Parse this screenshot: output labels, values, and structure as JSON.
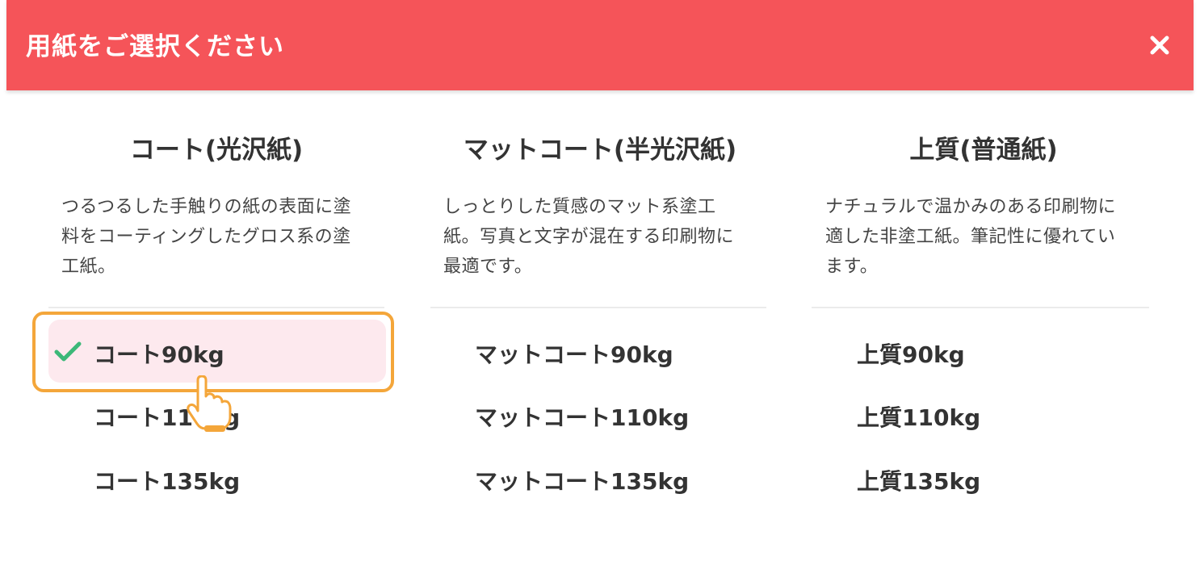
{
  "dialog": {
    "title": "用紙をご選択ください",
    "close_icon": "close-icon",
    "accent_color": "#f55459"
  },
  "columns": [
    {
      "heading": "コート(光沢紙)",
      "description": "つるつるした手触りの紙の表面に塗料をコーティングしたグロス系の塗工紙。",
      "options": [
        "コート90kg",
        "コート110kg",
        "コート135kg"
      ],
      "selected": "コート90kg"
    },
    {
      "heading": "マットコート(半光沢紙)",
      "description": "しっとりした質感のマット系塗工紙。写真と文字が混在する印刷物に最適です。",
      "options": [
        "マットコート90kg",
        "マットコート110kg",
        "マットコート135kg"
      ]
    },
    {
      "heading": "上質(普通紙)",
      "description": "ナチュラルで温かみのある印刷物に適した非塗工紙。筆記性に優れています。",
      "options": [
        "上質90kg",
        "上質110kg",
        "上質135kg"
      ]
    }
  ],
  "selection": {
    "check_icon": "check-icon",
    "check_color": "#3cb878",
    "highlight_color": "#f4a63a",
    "selected_bg_color": "#fde9ee",
    "pointer_icon": "hand-pointer-icon"
  }
}
